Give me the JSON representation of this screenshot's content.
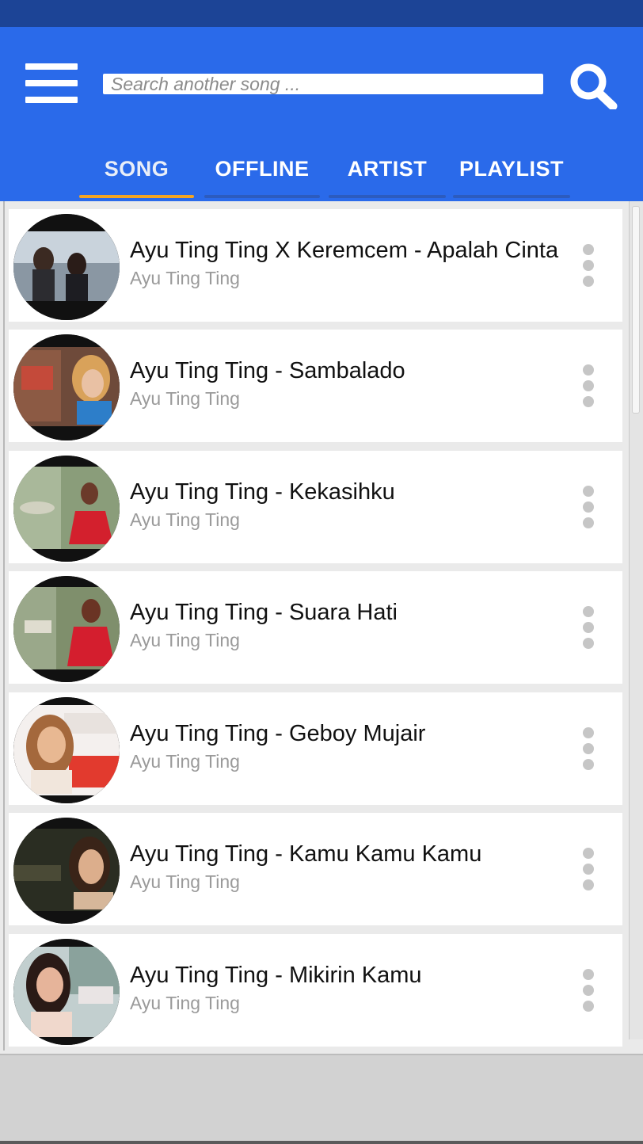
{
  "search": {
    "placeholder": "Search another song ...",
    "icon": "search-icon"
  },
  "menu": {
    "icon": "hamburger-menu-icon"
  },
  "colors": {
    "app_bar": "#2a6aea",
    "status_bar": "#1c4496",
    "tab_indicator": "#f3a424"
  },
  "tabs": [
    {
      "label": "SONG",
      "active": true
    },
    {
      "label": "OFFLINE",
      "active": false
    },
    {
      "label": "ARTIST",
      "active": false
    },
    {
      "label": "PLAYLIST",
      "active": false
    }
  ],
  "songs": [
    {
      "title": "Ayu Ting Ting X Keremcem - Apalah Cinta",
      "artist": "Ayu Ting Ting"
    },
    {
      "title": "Ayu Ting Ting - Sambalado",
      "artist": "Ayu Ting Ting"
    },
    {
      "title": "Ayu Ting Ting - Kekasihku",
      "artist": "Ayu Ting Ting"
    },
    {
      "title": "Ayu Ting Ting - Suara Hati",
      "artist": "Ayu Ting Ting"
    },
    {
      "title": "Ayu Ting Ting - Geboy Mujair",
      "artist": "Ayu Ting Ting"
    },
    {
      "title": "Ayu Ting Ting - Kamu Kamu Kamu",
      "artist": "Ayu Ting Ting"
    },
    {
      "title": "Ayu Ting Ting - Mikirin Kamu",
      "artist": "Ayu Ting Ting"
    }
  ]
}
